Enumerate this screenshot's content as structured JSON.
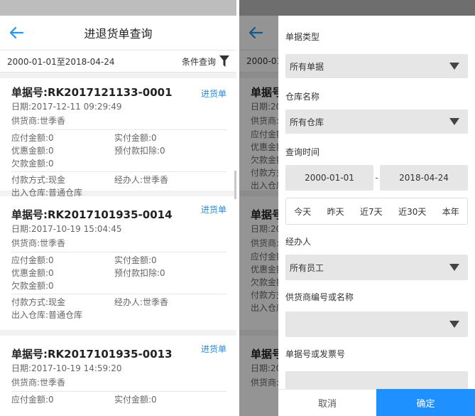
{
  "header": {
    "title": "进退货单查询",
    "date_range": "2000-01-01至2018-04-24",
    "filter_label": "条件查询"
  },
  "orders": [
    {
      "no": "单据号:RK2017121133-0001",
      "type": "进货单",
      "date": "日期:2017-12-11 09:29:49",
      "supplier": "供货商:世季香",
      "payable": "应付金额:0",
      "paid": "实付金额:0",
      "discount": "优惠金额:0",
      "prepay_deduct": "预付款扣除:0",
      "debt": "欠款金额:0",
      "pay_method": "付款方式:现金",
      "handler": "经办人:世季香",
      "warehouse": "出入仓库:普通仓库"
    },
    {
      "no": "单据号:RK2017101935-0014",
      "type": "进货单",
      "date": "日期:2017-10-19 15:04:45",
      "supplier": "供货商:世季香",
      "payable": "应付金额:0",
      "paid": "实付金额:0",
      "discount": "优惠金额:0",
      "prepay_deduct": "预付款扣除:0",
      "debt": "欠款金额:0",
      "pay_method": "付款方式:现金",
      "handler": "经办人:世季香",
      "warehouse": "出入仓库:普通仓库"
    },
    {
      "no": "单据号:RK2017101935-0013",
      "type": "进货单",
      "date": "日期:2017-10-19 14:59:20",
      "supplier": "供货商:世季香",
      "payable": "应付金额:0",
      "paid": "实付金额:0"
    }
  ],
  "right_bg": {
    "date_prefix": "2000-01",
    "no_prefix": "单据号",
    "date_short": "日期:20",
    "supplier_short": "供货商:",
    "payable_short": "应付金额",
    "discount_short": "优惠金额",
    "debt_short": "欠款金额",
    "pay_short": "付款方式",
    "wh_short": "出入仓库"
  },
  "filter": {
    "doc_type_label": "单据类型",
    "doc_type_value": "所有单据",
    "warehouse_label": "仓库名称",
    "warehouse_value": "所有仓库",
    "time_label": "查询时间",
    "start_date": "2000-01-01",
    "dash": "-",
    "end_date": "2018-04-24",
    "quick": [
      "今天",
      "昨天",
      "近7天",
      "近30天",
      "本年"
    ],
    "handler_label": "经办人",
    "handler_value": "所有员工",
    "supplier_label": "供货商编号或名称",
    "supplier_value": "",
    "docno_label": "单据号或发票号",
    "docno_value": "",
    "cancel": "取消",
    "confirm": "确定"
  },
  "colors": {
    "accent": "#1e90ff",
    "type_blue": "#2a8ad8",
    "back_arrow": "#2196f3"
  },
  "icons": [
    "back-arrow-icon",
    "filter-funnel-icon",
    "dropdown-triangle-icon"
  ]
}
